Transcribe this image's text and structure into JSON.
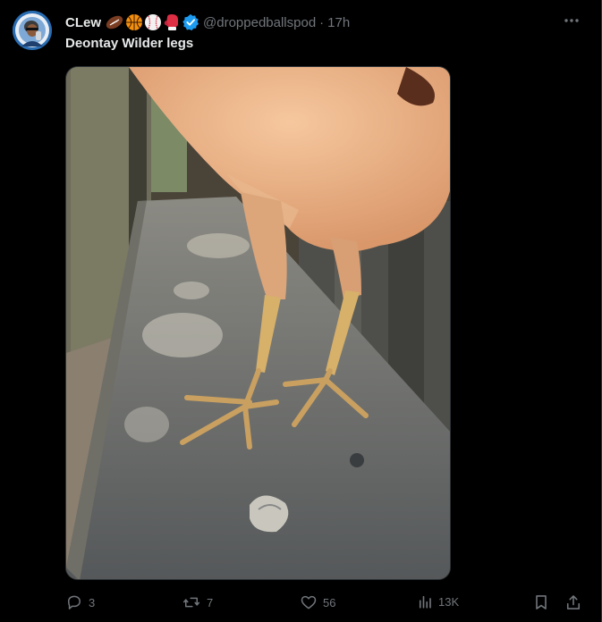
{
  "post": {
    "author_name": "CLew",
    "handle": "@droppedballspod",
    "separator": "·",
    "time": "17h",
    "text": "Deontay Wilder legs",
    "name_emojis": [
      "american-football-icon",
      "basketball-icon",
      "baseball-icon",
      "boxing-glove-icon"
    ],
    "verified_color": "#1d9bf0",
    "more_icon": "more-icon"
  },
  "media": {
    "alt": "Chicken legs standing on a wooden plank"
  },
  "actions": {
    "replies": "3",
    "reposts": "7",
    "likes": "56",
    "views": "13K"
  },
  "colors": {
    "background": "#000000",
    "text_primary": "#e7e9ea",
    "text_secondary": "#71767b",
    "accent": "#1d9bf0"
  }
}
